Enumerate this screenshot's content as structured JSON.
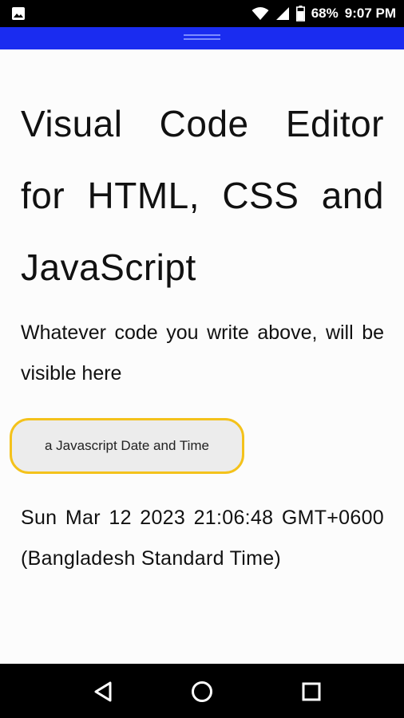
{
  "status_bar": {
    "battery_percent": "68%",
    "time": "9:07 PM",
    "icons": [
      "image-icon",
      "wifi-icon",
      "signal-icon",
      "battery-icon"
    ]
  },
  "preview": {
    "title": "Visual Code Editor for HTML, CSS and JavaScript",
    "intro": "Whatever code you write above, will be visible here",
    "button_label": "a Javascript Date and Time",
    "date_output": "Sun Mar 12 2023 21:06:48 GMT+0600 (Bangladesh Standard Time)"
  },
  "nav_bar": {
    "icons": [
      "back-icon",
      "home-icon",
      "recents-icon"
    ]
  },
  "colors": {
    "accent_bar": "#1a2cf0",
    "button_border": "#f4c21b",
    "button_bg": "#ececec"
  }
}
